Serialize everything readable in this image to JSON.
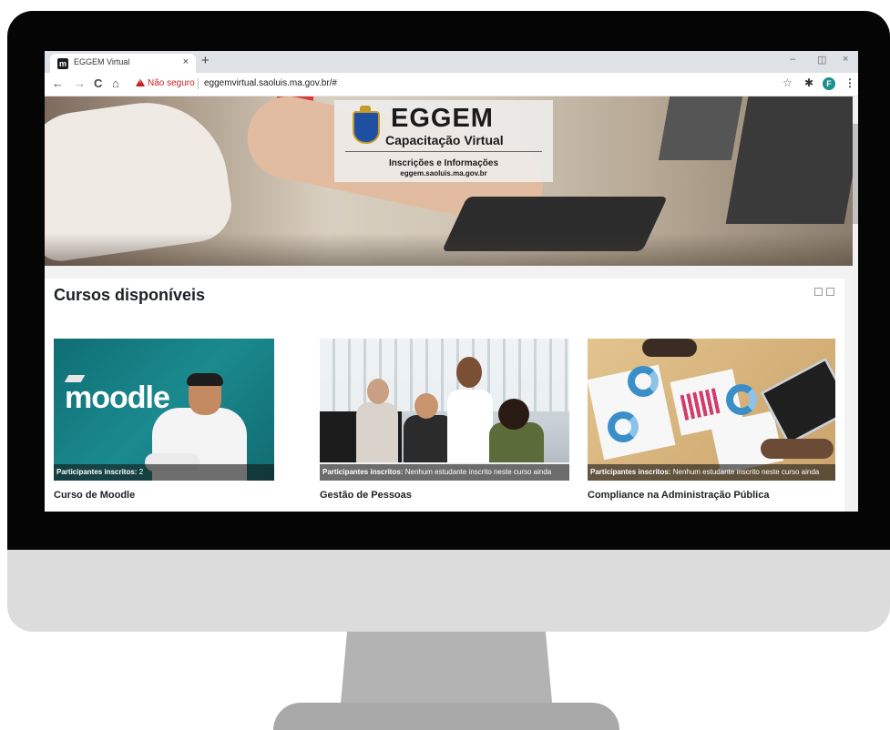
{
  "browser": {
    "tab_title": "EGGEM Virtual",
    "tab_favicon": "m",
    "tab_close": "×",
    "new_tab": "+",
    "minimize": "–",
    "restore": "◫",
    "close": "×",
    "back": "←",
    "forward": "→",
    "reload": "C",
    "home": "⌂",
    "security_label": "Não seguro",
    "url": "eggemvirtual.saoluis.ma.gov.br/#",
    "star": "☆",
    "extensions": "✱",
    "profile_initial": "F",
    "menu": "⋮"
  },
  "hero": {
    "logo_title": "EGGEM",
    "logo_subtitle": "Capacitação Virtual",
    "info_line1": "Inscrições e Informações",
    "info_line2": "eggem.saoluis.ma.gov.br"
  },
  "courses": {
    "section_title": "Cursos disponíveis",
    "caption_label": "Participantes inscritos:",
    "items": [
      {
        "image_text": "moodle",
        "caption_value": "2",
        "title": "Curso de Moodle"
      },
      {
        "caption_value": "Nenhum estudante inscrito neste curso ainda",
        "title": "Gestão de Pessoas"
      },
      {
        "caption_value": "Nenhum estudante inscrito neste curso ainda",
        "title": "Compliance na Administração Pública"
      }
    ]
  },
  "colors": {
    "insecure_red": "#c5221f",
    "moodle_teal": "#1a8a8f",
    "avatar_teal": "#1e8e8e"
  },
  "icons": [
    "crest-icon",
    "warning-icon",
    "star-icon",
    "extensions-icon",
    "menu-icon"
  ]
}
